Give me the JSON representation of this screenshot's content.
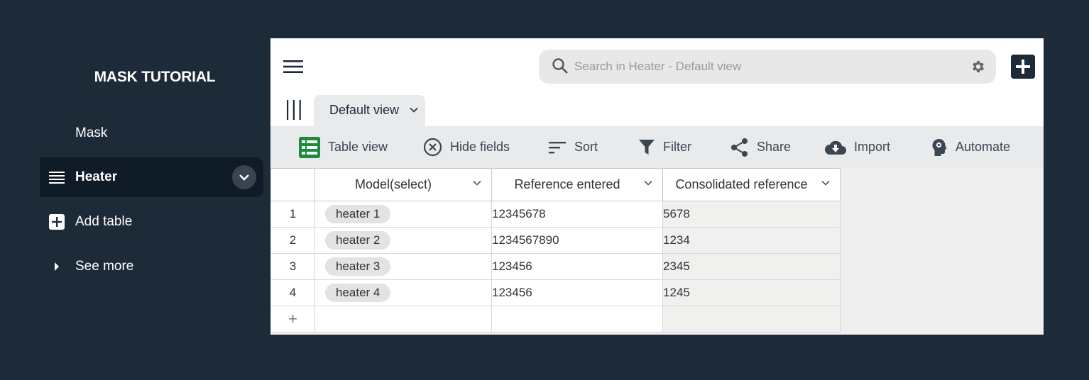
{
  "app": {
    "title": "MASK TUTORIAL"
  },
  "sidebar": {
    "items": [
      {
        "label": "Mask"
      },
      {
        "label": "Heater",
        "active": true
      },
      {
        "label": "Add table"
      },
      {
        "label": "See more"
      }
    ]
  },
  "header": {
    "search_placeholder": "Search in Heater  - Default view"
  },
  "view": {
    "tab_label": "Default view"
  },
  "toolbar": {
    "table_view": "Table view",
    "hide_fields": "Hide fields",
    "sort": "Sort",
    "filter": "Filter",
    "share": "Share",
    "import": "Import",
    "automate": "Automate"
  },
  "table": {
    "columns": [
      "Model(select)",
      "Reference entered",
      "Consolidated reference"
    ],
    "rows": [
      {
        "num": "1",
        "model": "heater 1",
        "reference": "12345678",
        "consolidated": "5678"
      },
      {
        "num": "2",
        "model": "heater 2",
        "reference": "1234567890",
        "consolidated": "1234"
      },
      {
        "num": "3",
        "model": "heater 3",
        "reference": "123456",
        "consolidated": "2345"
      },
      {
        "num": "4",
        "model": "heater 4",
        "reference": "123456",
        "consolidated": "1245"
      }
    ],
    "add_row_symbol": "+"
  },
  "colors": {
    "background": "#1d2a38",
    "active_item": "#0f1c27",
    "toolbar": "#e9eaeb",
    "table_view_icon": "#1e8a3c"
  },
  "icons": {
    "menu": "hamburger-icon",
    "search": "search-icon",
    "settings": "gear-icon",
    "add": "plus-icon",
    "views": "views-list-icon",
    "table_view": "table-view-icon",
    "hide": "hide-circle-x-icon",
    "sort": "sort-lines-icon",
    "filter": "filter-funnel-icon",
    "share": "share-icon",
    "import": "cloud-download-icon",
    "automate": "automate-head-gear-icon"
  }
}
